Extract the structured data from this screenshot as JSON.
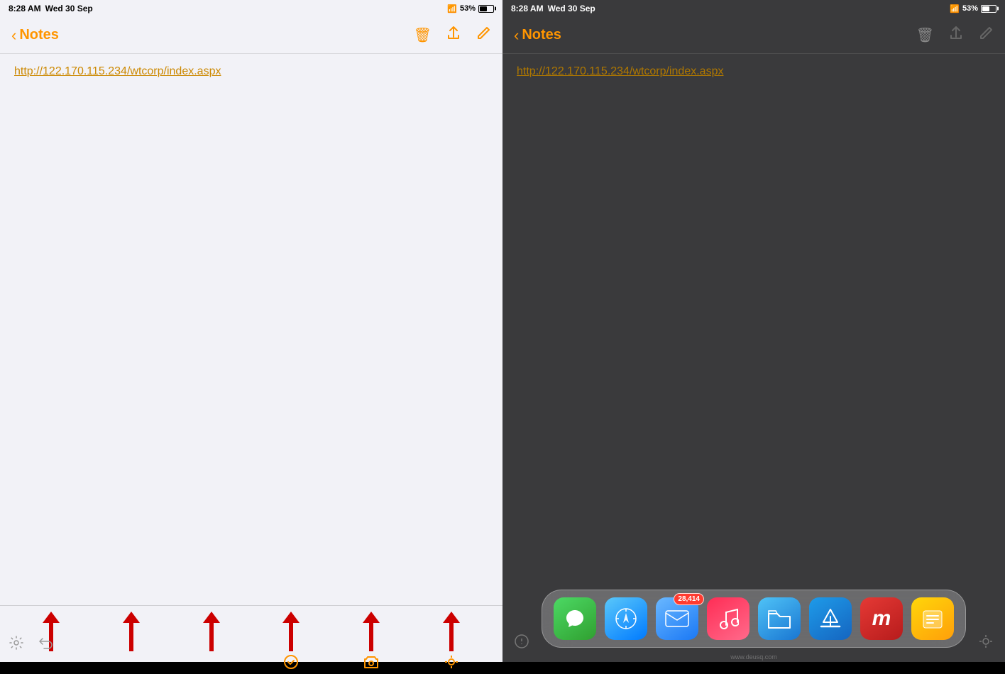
{
  "left": {
    "status_bar": {
      "time": "8:28 AM",
      "date": "Wed 30 Sep",
      "wifi": "📶",
      "battery_percent": "53%"
    },
    "nav": {
      "back_label": "Notes",
      "delete_icon": "🗑",
      "share_icon": "⬆",
      "compose_icon": "✏"
    },
    "note": {
      "link": "http://122.170.115.234/wtcorp/index.aspx"
    },
    "toolbar": {
      "check_icon": "✓",
      "camera_icon": "📷",
      "location_icon": "◎"
    }
  },
  "right": {
    "status_bar": {
      "time": "8:28 AM",
      "date": "Wed 30 Sep",
      "wifi": "📶",
      "battery_percent": "53%"
    },
    "nav": {
      "back_label": "Notes",
      "delete_icon": "🗑",
      "share_icon": "⬆",
      "compose_icon": "✏"
    },
    "note": {
      "link": "http://122.170.115.234/wtcorp/index.aspx"
    },
    "dock": {
      "apps": [
        {
          "name": "Messages",
          "class": "dock-messages",
          "icon": "💬",
          "badge": null
        },
        {
          "name": "Safari",
          "class": "dock-safari",
          "icon": "🧭",
          "badge": null
        },
        {
          "name": "Mail",
          "class": "dock-mail",
          "icon": "✉",
          "badge": "28,414"
        },
        {
          "name": "Music",
          "class": "dock-music",
          "icon": "♪",
          "badge": null
        },
        {
          "name": "Files",
          "class": "dock-files",
          "icon": "📁",
          "badge": null
        },
        {
          "name": "App Store",
          "class": "dock-appstore",
          "icon": "A",
          "badge": null
        },
        {
          "name": "MyApp",
          "class": "dock-myapp",
          "icon": "m",
          "badge": null
        },
        {
          "name": "Notes",
          "class": "dock-notes",
          "icon": "≡",
          "badge": null
        }
      ]
    }
  }
}
